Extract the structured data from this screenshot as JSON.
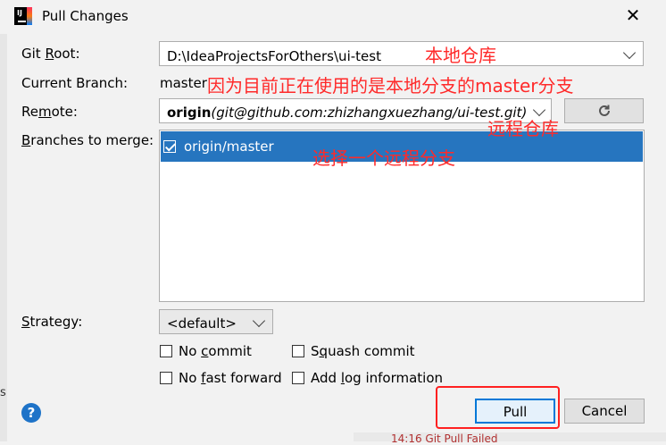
{
  "window": {
    "title": "Pull Changes"
  },
  "fields": {
    "git_root_label": "Git Root:",
    "git_root_value": "D:\\IdeaProjectsForOthers\\ui-test",
    "current_branch_label": "Current Branch:",
    "current_branch_value": "master",
    "remote_label": "Remote:",
    "remote_name": "origin",
    "remote_url": "(git@github.com:zhizhangxuezhang/ui-test.git)",
    "branches_label": "Branches to merge:",
    "strategy_label": "Strategy:",
    "strategy_value": "<default>"
  },
  "branches": [
    {
      "name": "origin/master",
      "checked": true,
      "selected": true
    }
  ],
  "options": {
    "no_commit": "No commit",
    "squash_commit": "Squash commit",
    "no_fast_forward": "No fast forward",
    "add_log_information": "Add log information"
  },
  "buttons": {
    "pull": "Pull",
    "cancel": "Cancel",
    "help": "?"
  },
  "annotations": {
    "local_repo": "本地仓库",
    "current_branch_note": "因为目前正在使用的是本地分支的master分支",
    "remote_repo": "远程仓库",
    "choose_branch": "选择一个远程分支"
  },
  "background": {
    "partial_text": "14:16  Git Pull Failed",
    "edge_text": "s"
  },
  "colors": {
    "selection": "#2675bf",
    "annotation": "#ff2a2a",
    "default_button_border": "#0078d7"
  },
  "icons": [
    "intellij-icon",
    "close-icon",
    "chevron-down-icon",
    "refresh-icon",
    "checkbox-checked-icon",
    "help-icon"
  ]
}
